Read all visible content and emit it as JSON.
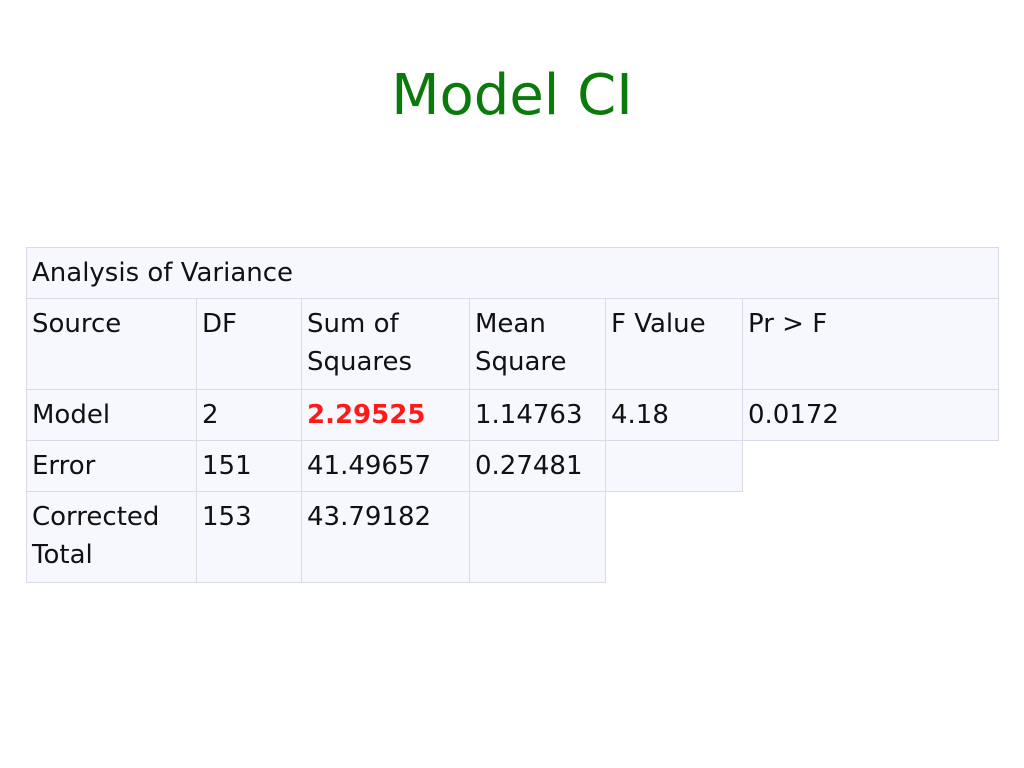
{
  "slide": {
    "title": "Model CI"
  },
  "table": {
    "caption": "Analysis of Variance",
    "headers": [
      "Source",
      "DF",
      "Sum of Squares",
      "Mean Square",
      "F Value",
      "Pr > F"
    ],
    "rows": [
      {
        "source": "Model",
        "df": "2",
        "ss": "2.29525",
        "ms": "1.14763",
        "f": "4.18",
        "p": "0.0172"
      },
      {
        "source": "Error",
        "df": "151",
        "ss": "41.49657",
        "ms": "0.27481",
        "f": ""
      },
      {
        "source": "Corrected Total",
        "df": "153",
        "ss": "43.79182"
      }
    ],
    "highlight_color": "#ff1a1a"
  }
}
